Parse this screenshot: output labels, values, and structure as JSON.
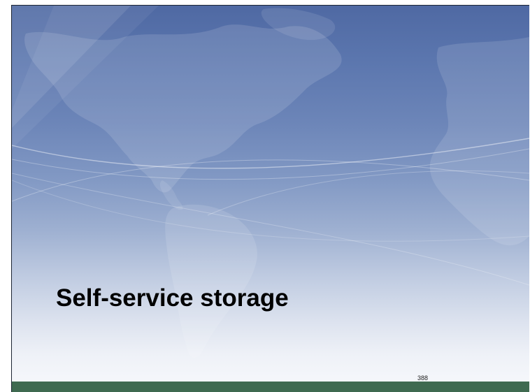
{
  "slide": {
    "title": "Self-service storage",
    "page_number": "388"
  },
  "colors": {
    "sky_top": "#4f69a3",
    "sky_bottom": "#f4f6fa",
    "bottom_band": "#3f6a50",
    "title_text": "#000000"
  },
  "background": {
    "art": "world-map-globe-icon"
  }
}
